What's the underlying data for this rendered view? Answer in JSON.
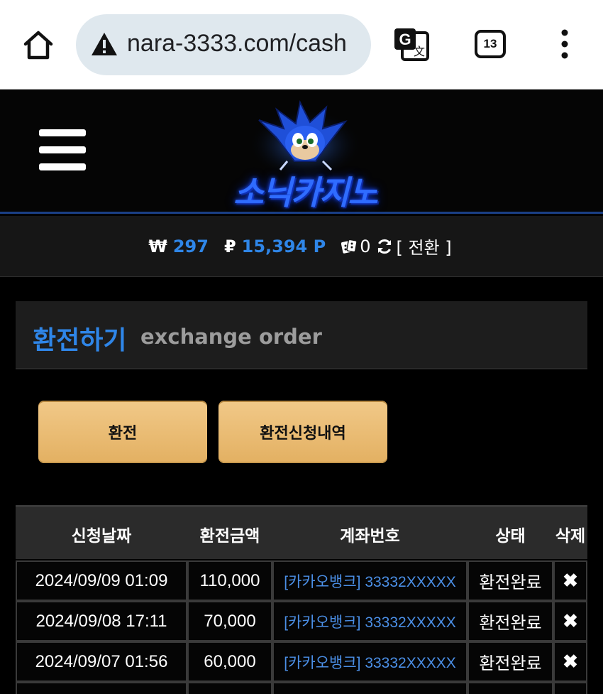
{
  "browser": {
    "url": "nara-3333.com/cash",
    "tab_count": "13"
  },
  "site": {
    "logo_text": "소닉카지노"
  },
  "balance": {
    "won_symbol": "₩",
    "won_value": "297",
    "point_symbol": "₽",
    "point_value": "15,394 P",
    "chip_value": "0",
    "convert_label": "[ 전환 ]"
  },
  "page": {
    "title_ko": "환전하기",
    "title_en": "exchange order",
    "btn_exchange": "환전",
    "btn_history": "환전신청내역"
  },
  "table": {
    "headers": [
      "신청날짜",
      "환전금액",
      "계좌번호",
      "상태",
      "삭제"
    ],
    "rows": [
      {
        "date": "2024/09/09 01:09",
        "amount": "110,000",
        "account": "[카카오뱅크] 33332XXXXX",
        "status": "환전완료",
        "delete": "✖"
      },
      {
        "date": "2024/09/08 17:11",
        "amount": "70,000",
        "account": "[카카오뱅크] 33332XXXXX",
        "status": "환전완료",
        "delete": "✖"
      },
      {
        "date": "2024/09/07 01:56",
        "amount": "60,000",
        "account": "[카카오뱅크] 33332XXXXX",
        "status": "환전완료",
        "delete": "✖"
      }
    ]
  }
}
